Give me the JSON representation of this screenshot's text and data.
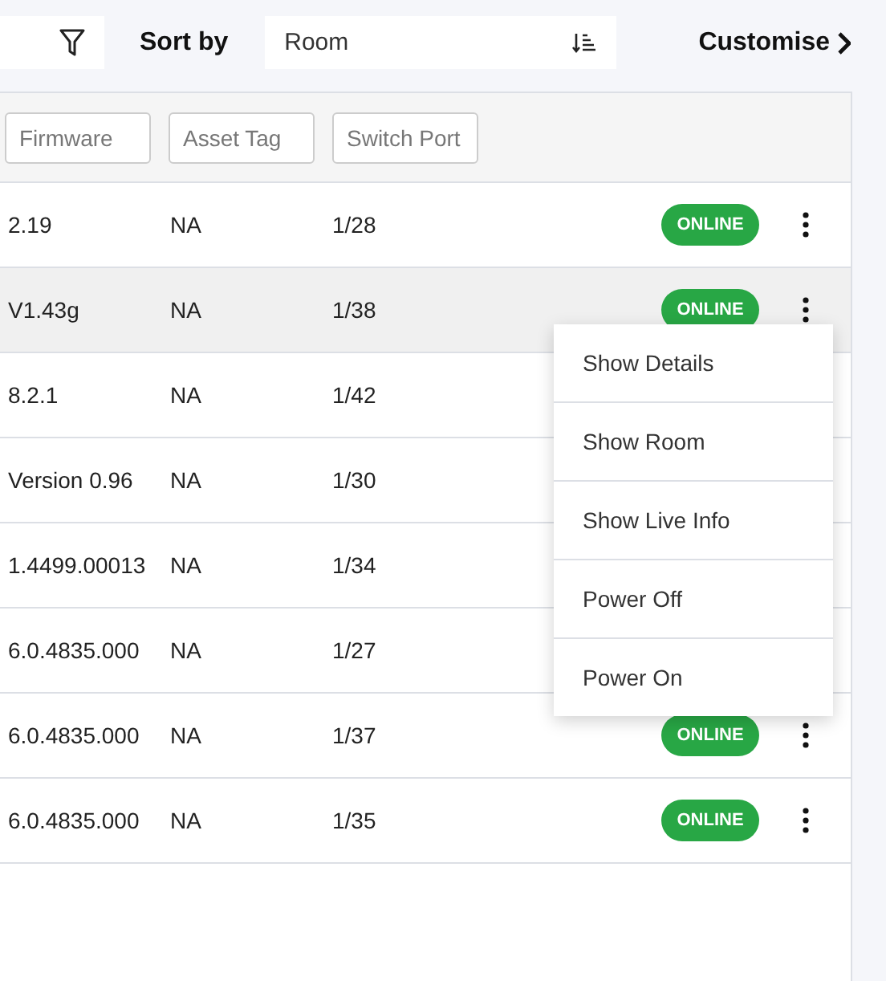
{
  "toolbar": {
    "sort_label": "Sort by",
    "sort_field": {
      "value": "Room"
    },
    "customise_link": "Customise"
  },
  "filters": [
    {
      "placeholder": "Firmware"
    },
    {
      "placeholder": "Asset Tag"
    },
    {
      "placeholder": "Switch Port"
    }
  ],
  "rows": [
    {
      "firmware": "2.19",
      "asset_tag": "NA",
      "switch_port": "1/28",
      "status": "ONLINE",
      "selected": false
    },
    {
      "firmware": "V1.43g",
      "asset_tag": "NA",
      "switch_port": "1/38",
      "status": "ONLINE",
      "selected": true
    },
    {
      "firmware": "8.2.1",
      "asset_tag": "NA",
      "switch_port": "1/42",
      "selected": false
    },
    {
      "firmware": "Version 0.96",
      "asset_tag": "NA",
      "switch_port": "1/30",
      "selected": false
    },
    {
      "firmware": "1.4499.00013",
      "asset_tag": "NA",
      "switch_port": "1/34",
      "selected": false
    },
    {
      "firmware": "6.0.4835.000",
      "asset_tag": "NA",
      "switch_port": "1/27",
      "selected": false
    },
    {
      "firmware": "6.0.4835.000",
      "asset_tag": "NA",
      "switch_port": "1/37",
      "status": "ONLINE",
      "selected": false
    },
    {
      "firmware": "6.0.4835.000",
      "asset_tag": "NA",
      "switch_port": "1/35",
      "status": "ONLINE",
      "selected": false
    }
  ],
  "context_menu": {
    "items": [
      "Show Details",
      "Show Room",
      "Show Live Info",
      "Power Off",
      "Power On"
    ]
  }
}
